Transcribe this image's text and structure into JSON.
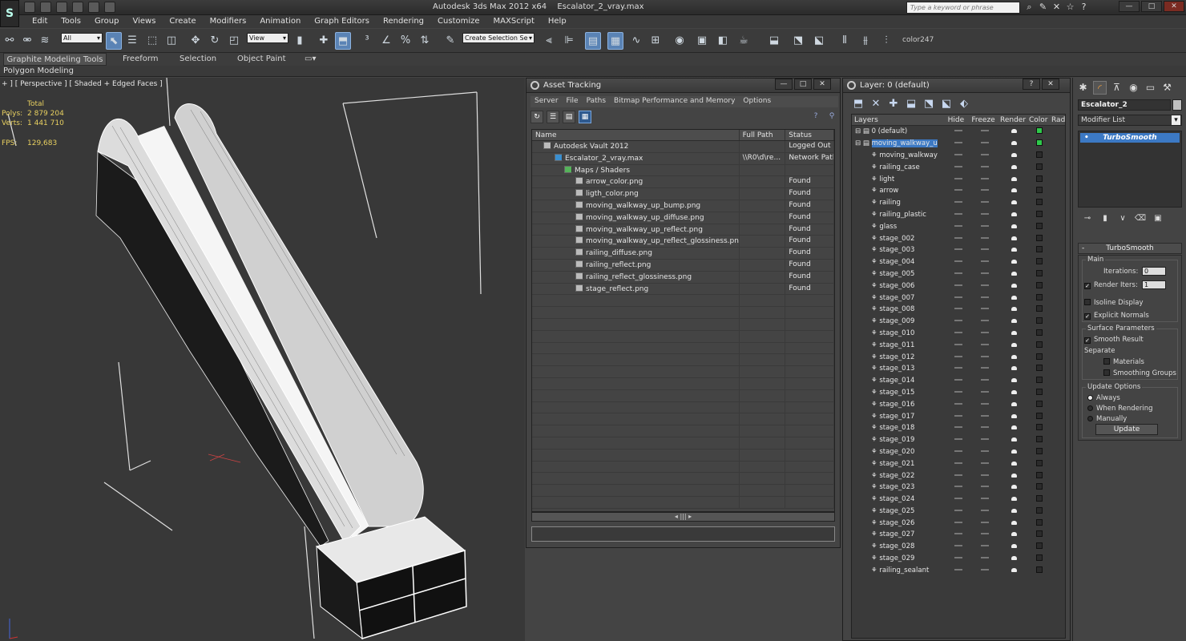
{
  "title": {
    "app": "Autodesk 3ds Max  2012 x64",
    "file": "Escalator_2_vray.max",
    "search_placeholder": "Type a keyword or phrase"
  },
  "menu": [
    "Edit",
    "Tools",
    "Group",
    "Views",
    "Create",
    "Modifiers",
    "Animation",
    "Graph Editors",
    "Rendering",
    "Customize",
    "MAXScript",
    "Help"
  ],
  "toolbar": {
    "filter": "All",
    "ref_coord": "View",
    "selection_set_placeholder": "Create Selection Se",
    "layer_color": "color247"
  },
  "ribbon": {
    "tabs": [
      "Graphite Modeling Tools",
      "Freeform",
      "Selection",
      "Object Paint"
    ],
    "sub": "Polygon Modeling"
  },
  "viewport": {
    "label": "+ ] [ Perspective ] [ Shaded + Edged Faces ]",
    "stats": {
      "total_label": "Total",
      "polys_label": "Polys:",
      "polys": "2 879 204",
      "verts_label": "Verts:",
      "verts": "1 441 710",
      "fps_label": "FPS:",
      "fps": "129,683"
    }
  },
  "asset_tracking": {
    "title": "Asset Tracking",
    "menu": [
      "Server",
      "File",
      "Paths",
      "Bitmap Performance and Memory",
      "Options"
    ],
    "columns": [
      "Name",
      "Full Path",
      "Status"
    ],
    "rows": [
      {
        "name": "Autodesk Vault 2012",
        "path": "",
        "status": "Logged Out ..."
      },
      {
        "name": "Escalator_2_vray.max",
        "path": "\\\\R0\\d\\re...",
        "status": "Network Path"
      },
      {
        "name": "Maps / Shaders",
        "path": "",
        "status": ""
      },
      {
        "name": "arrow_color.png",
        "path": "",
        "status": "Found"
      },
      {
        "name": "ligth_color.png",
        "path": "",
        "status": "Found"
      },
      {
        "name": "moving_walkway_up_bump.png",
        "path": "",
        "status": "Found"
      },
      {
        "name": "moving_walkway_up_diffuse.png",
        "path": "",
        "status": "Found"
      },
      {
        "name": "moving_walkway_up_reflect.png",
        "path": "",
        "status": "Found"
      },
      {
        "name": "moving_walkway_up_reflect_glossiness.png",
        "path": "",
        "status": "Found"
      },
      {
        "name": "railing_diffuse.png",
        "path": "",
        "status": "Found"
      },
      {
        "name": "railing_reflect.png",
        "path": "",
        "status": "Found"
      },
      {
        "name": "railing_reflect_glossiness.png",
        "path": "",
        "status": "Found"
      },
      {
        "name": "stage_reflect.png",
        "path": "",
        "status": "Found"
      }
    ]
  },
  "layers": {
    "title": "Layer: 0 (default)",
    "columns": [
      "Layers",
      "Hide",
      "Freeze",
      "Render",
      "Color",
      "Rad"
    ],
    "top": [
      {
        "name": "0 (default)",
        "color": "#2ec94a"
      },
      {
        "name": "moving_walkway_u",
        "color": "#2ec94a"
      }
    ],
    "items": [
      "moving_walkway",
      "railing_case",
      "light",
      "arrow",
      "railing",
      "railing_plastic",
      "glass",
      "stage_002",
      "stage_003",
      "stage_004",
      "stage_005",
      "stage_006",
      "stage_007",
      "stage_008",
      "stage_009",
      "stage_010",
      "stage_011",
      "stage_012",
      "stage_013",
      "stage_014",
      "stage_015",
      "stage_016",
      "stage_017",
      "stage_018",
      "stage_019",
      "stage_020",
      "stage_021",
      "stage_022",
      "stage_023",
      "stage_024",
      "stage_025",
      "stage_026",
      "stage_027",
      "stage_028",
      "stage_029",
      "railing_sealant"
    ]
  },
  "command_panel": {
    "object_name": "Escalator_2",
    "modifier_list": "Modifier List",
    "stack": [
      "TurboSmooth"
    ],
    "rollout": "TurboSmooth",
    "main_label": "Main",
    "iterations_label": "Iterations:",
    "iterations": "0",
    "render_iters_label": "Render Iters:",
    "render_iters": "1",
    "isoline_label": "Isoline Display",
    "explicit_label": "Explicit Normals",
    "surface_label": "Surface Parameters",
    "smooth_label": "Smooth Result",
    "separate_label": "Separate",
    "materials_label": "Materials",
    "smoothing_label": "Smoothing Groups",
    "update_label": "Update Options",
    "always_label": "Always",
    "when_rendering_label": "When Rendering",
    "manually_label": "Manually",
    "update_button": "Update"
  },
  "colors": {
    "selection": "#3c79c4",
    "stats_text": "#e8d060",
    "layer_green": "#2ec94a"
  }
}
